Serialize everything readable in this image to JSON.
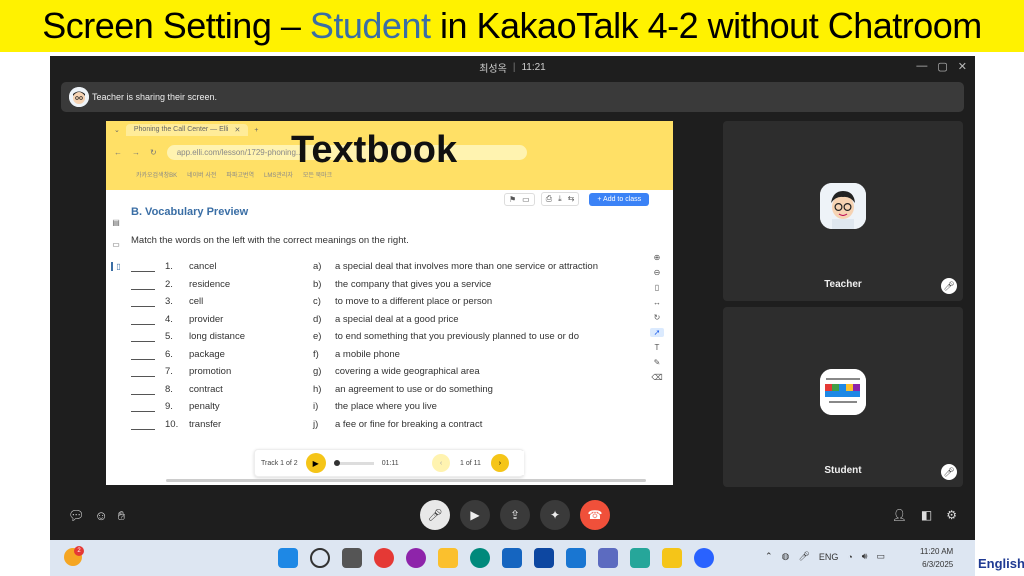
{
  "banner": {
    "title_part1": "Screen Setting – ",
    "title_highlight": "Student",
    "title_part2": " in KakaoTalk 4-2 without Chatroom"
  },
  "window": {
    "caller_name": "최성옥",
    "call_time": "11:21",
    "controls": [
      "—",
      "▢",
      "✕"
    ]
  },
  "share_notice": "Teacher is sharing their screen.",
  "overlay_label": "Textbook",
  "browser": {
    "tab_title": "Phoning the Call Center — Elli",
    "url": "app.elli.com/lesson/1729-phoning...",
    "bookmarks": [
      "카카오검색창BK",
      "네이버 사전",
      "파파고번역",
      "LMS관리자",
      "모든 북마크"
    ]
  },
  "lesson": {
    "add_to_class": "+ Add to class",
    "section_title": "B. Vocabulary Preview",
    "instruction": "Match the words on the left with the correct meanings on the right.",
    "rows": [
      {
        "num": "1.",
        "word": "cancel",
        "letter": "a)",
        "def": "a special deal that involves more than one service or attraction"
      },
      {
        "num": "2.",
        "word": "residence",
        "letter": "b)",
        "def": "the company that gives you a service"
      },
      {
        "num": "3.",
        "word": "cell",
        "letter": "c)",
        "def": "to move to a different place or person"
      },
      {
        "num": "4.",
        "word": "provider",
        "letter": "d)",
        "def": "a special deal at a good price"
      },
      {
        "num": "5.",
        "word": "long distance",
        "letter": "e)",
        "def": "to end something that you previously planned to use or do"
      },
      {
        "num": "6.",
        "word": "package",
        "letter": "f)",
        "def": "a mobile phone"
      },
      {
        "num": "7.",
        "word": "promotion",
        "letter": "g)",
        "def": "covering a wide geographical area"
      },
      {
        "num": "8.",
        "word": "contract",
        "letter": "h)",
        "def": "an agreement to use or do something"
      },
      {
        "num": "9.",
        "word": "penalty",
        "letter": "i)",
        "def": "the place where you live"
      },
      {
        "num": "10.",
        "word": "transfer",
        "letter": "j)",
        "def": "a fee or fine for breaking a contract"
      }
    ],
    "audio": {
      "track": "Track 1 of 2",
      "time": "01:11"
    },
    "pager": "1 of 11"
  },
  "participants": [
    {
      "name": "Teacher"
    },
    {
      "name": "Student"
    }
  ],
  "taskbar": {
    "weather_badge": "2",
    "lang": "ENG",
    "time": "11:20 AM",
    "date": "6/3/2025"
  },
  "corner_text": "English",
  "colors": {
    "banner": "#fff200",
    "highlight": "#3a6ea5",
    "end_call": "#f0503a",
    "kakao_yellow": "#f5c518"
  }
}
